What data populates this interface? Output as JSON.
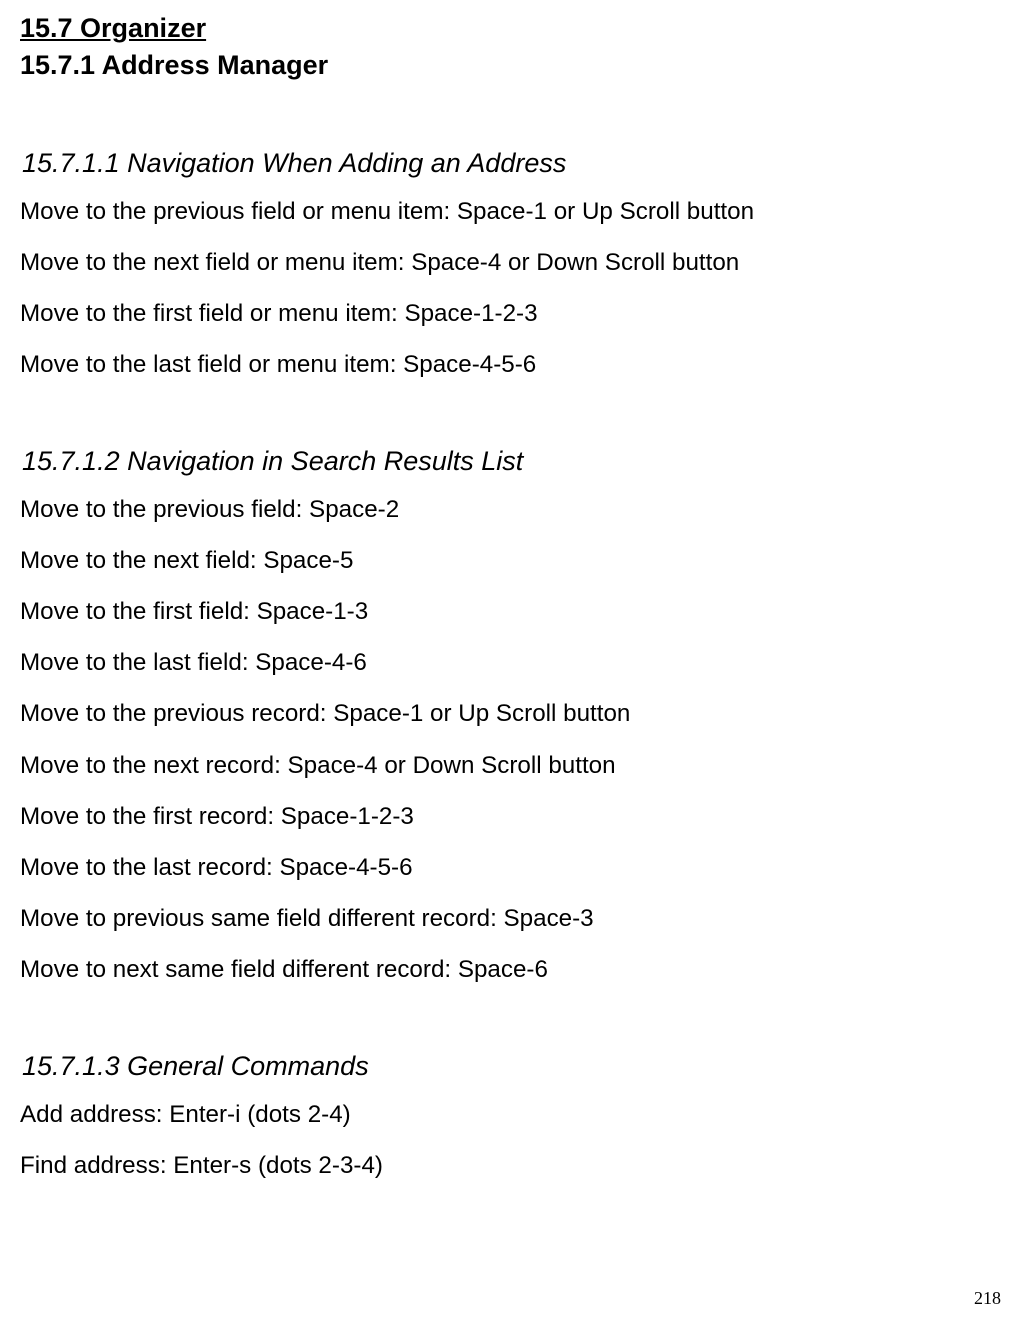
{
  "heading1": "15.7 Organizer",
  "heading2": "15.7.1 Address Manager",
  "section1": {
    "title": "15.7.1.1 Navigation When Adding an Address",
    "lines": [
      "Move to the previous field or menu item: Space-1 or Up Scroll button",
      "Move to the next field or menu item: Space-4 or Down Scroll button",
      "Move to the first field or menu item: Space-1-2-3",
      "Move to the last field or menu item: Space-4-5-6"
    ]
  },
  "section2": {
    "title": "15.7.1.2 Navigation in Search Results List",
    "lines": [
      "Move to the previous field: Space-2",
      "Move to the next field: Space-5",
      "Move to the first field: Space-1-3",
      "Move to the last field: Space-4-6",
      "Move to the previous record: Space-1 or Up Scroll button",
      "Move to the next record: Space-4 or Down Scroll button",
      "Move to the first record: Space-1-2-3",
      "Move to the last record: Space-4-5-6",
      "Move to previous same field different record: Space-3",
      "Move to next same field different record: Space-6"
    ]
  },
  "section3": {
    "title": "15.7.1.3 General Commands",
    "lines": [
      "Add address: Enter-i (dots 2-4)",
      "Find address: Enter-s (dots 2-3-4)"
    ]
  },
  "page_number": "218"
}
